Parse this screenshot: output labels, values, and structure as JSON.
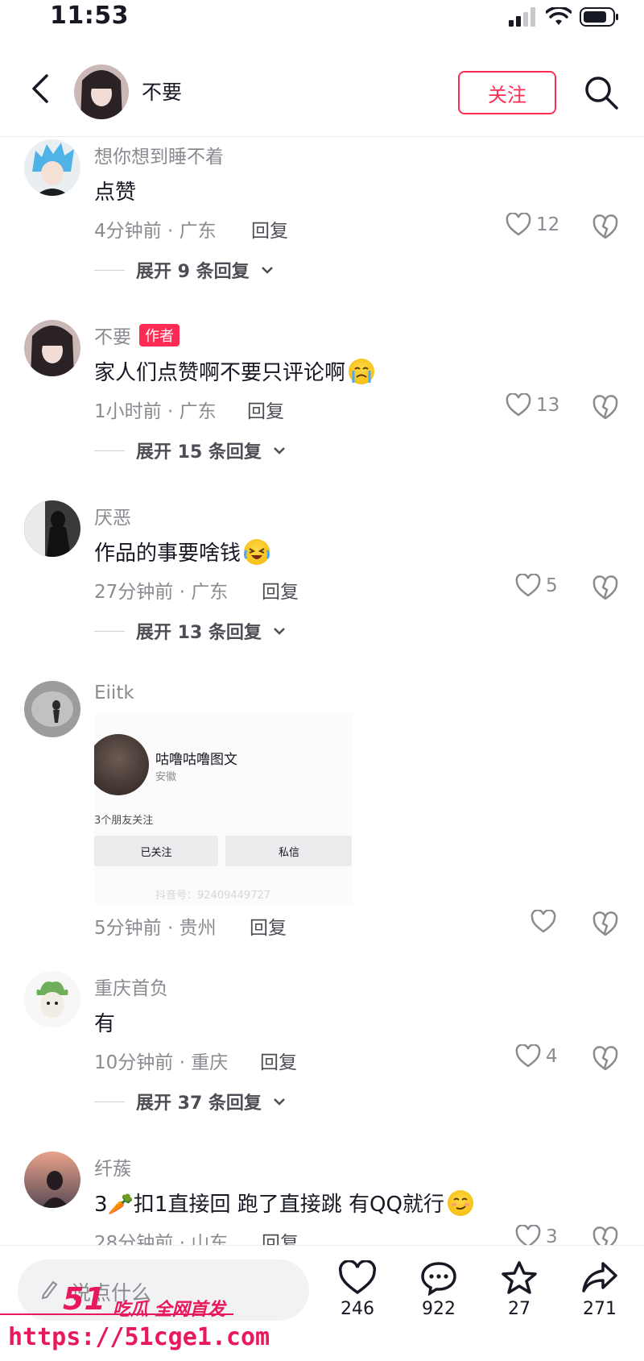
{
  "status": {
    "time": "11:53"
  },
  "header": {
    "name": "不要",
    "follow_label": "关注"
  },
  "comments": [
    {
      "user": "想你想到睡不着",
      "text": "点赞",
      "meta": "4分钟前 · 广东",
      "reply": "回复",
      "likes": "12",
      "expand": "展开 9 条回复"
    },
    {
      "user": "不要",
      "badge": "作者",
      "text": "家人们点赞啊不要只评论啊",
      "emoji": "crying-face",
      "meta": "1小时前 · 广东",
      "reply": "回复",
      "likes": "13",
      "expand": "展开 15 条回复"
    },
    {
      "user": "厌恶",
      "text": "作品的事要啥钱",
      "emoji": "laughing-crying-face",
      "meta": "27分钟前 · 广东",
      "reply": "回复",
      "likes": "5",
      "expand": "展开 13 条回复"
    },
    {
      "user": "Eiitk",
      "image": {
        "name": "咕噜咕噜图文",
        "location": "安徽",
        "friends": "3个朋友关注",
        "btn1": "已关注",
        "btn2": "私信",
        "id": "抖音号：92409449727"
      },
      "meta": "5分钟前 · 贵州",
      "reply": "回复",
      "likes": ""
    },
    {
      "user": "重庆首负",
      "text": "有",
      "meta": "10分钟前 · 重庆",
      "reply": "回复",
      "likes": "4",
      "expand": "展开 37 条回复"
    },
    {
      "user": "纤蔟",
      "text": "3🥕扣1直接回  跑了直接跳 有QQ就行",
      "emoji": "smirk-face",
      "meta": "28分钟前 · 山东",
      "reply": "回复",
      "likes": "3"
    }
  ],
  "bottom": {
    "placeholder": "说点什么",
    "actions": [
      {
        "icon": "heart-icon",
        "count": "246"
      },
      {
        "icon": "comment-icon",
        "count": "922"
      },
      {
        "icon": "star-icon",
        "count": "27"
      },
      {
        "icon": "share-icon",
        "count": "271"
      }
    ]
  },
  "watermark": {
    "brand": "51",
    "slogan": "吃瓜 全网首发",
    "url": "https://51cge1.com"
  },
  "colors": {
    "accent": "#fe2c55",
    "text": "#161823",
    "muted": "#8a8b91"
  }
}
